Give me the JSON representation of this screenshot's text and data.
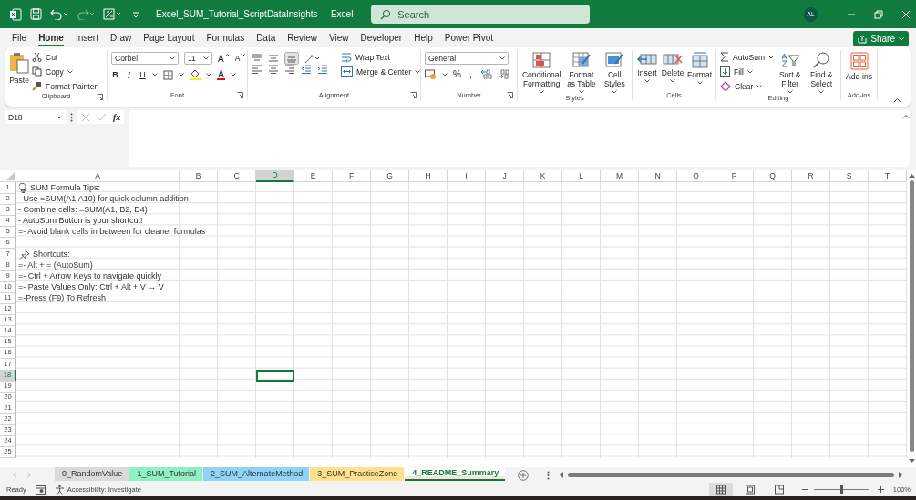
{
  "title_bar": {
    "title": "Excel_SUM_Tutorial_ScriptDataInsights  -  Excel",
    "search": {
      "placeholder": "Search"
    },
    "avatar": "AL"
  },
  "menu_tabs": [
    {
      "label": "File",
      "selected": false
    },
    {
      "label": "Home",
      "selected": true
    },
    {
      "label": "Insert",
      "selected": false
    },
    {
      "label": "Draw",
      "selected": false
    },
    {
      "label": "Page Layout",
      "selected": false
    },
    {
      "label": "Formulas",
      "selected": false
    },
    {
      "label": "Data",
      "selected": false
    },
    {
      "label": "Review",
      "selected": false
    },
    {
      "label": "View",
      "selected": false
    },
    {
      "label": "Developer",
      "selected": false
    },
    {
      "label": "Help",
      "selected": false
    },
    {
      "label": "Power Pivot",
      "selected": false
    }
  ],
  "share_button": "Share",
  "ribbon": {
    "clipboard": {
      "paste": "Paste",
      "cut": "Cut",
      "copy": "Copy",
      "format_painter": "Format Painter",
      "label": "Clipboard"
    },
    "font": {
      "font_name": "Corbel",
      "font_size": "11",
      "grow": "A",
      "shrink": "A",
      "bold": "B",
      "italic": "I",
      "underline": "U",
      "font_color": "A",
      "label": "Font"
    },
    "alignment": {
      "wrap_text": "Wrap Text",
      "merge_center": "Merge & Center",
      "label": "Alignment"
    },
    "number": {
      "format": "General",
      "percent": "%",
      "comma": ",",
      "label": "Number"
    },
    "styles": {
      "conditional_formatting": "Conditional Formatting",
      "format_as_table": "Format as Table",
      "cell_styles": "Cell Styles",
      "label": "Styles"
    },
    "cells": {
      "insert": "Insert",
      "delete": "Delete",
      "format": "Format",
      "label": "Cells"
    },
    "editing": {
      "autosum": "AutoSum",
      "fill": "Fill",
      "clear": "Clear",
      "sort_filter": "Sort & Filter",
      "find_select": "Find & Select",
      "label": "Editing"
    },
    "add_ins": {
      "button": "Add-ins",
      "label": "Add-ins"
    }
  },
  "formula_bar": {
    "name_box": "D18",
    "fx": "fx"
  },
  "sheet": {
    "columns": [
      {
        "label": "A",
        "selected": false
      },
      {
        "label": "B",
        "selected": false
      },
      {
        "label": "C",
        "selected": false
      },
      {
        "label": "D",
        "selected": true
      },
      {
        "label": "E",
        "selected": false
      },
      {
        "label": "F",
        "selected": false
      },
      {
        "label": "G",
        "selected": false
      },
      {
        "label": "H",
        "selected": false
      },
      {
        "label": "I",
        "selected": false
      },
      {
        "label": "J",
        "selected": false
      },
      {
        "label": "K",
        "selected": false
      },
      {
        "label": "L",
        "selected": false
      },
      {
        "label": "M",
        "selected": false
      },
      {
        "label": "N",
        "selected": false
      },
      {
        "label": "O",
        "selected": false
      },
      {
        "label": "P",
        "selected": false
      },
      {
        "label": "Q",
        "selected": false
      },
      {
        "label": "R",
        "selected": false
      },
      {
        "label": "S",
        "selected": false
      },
      {
        "label": "T",
        "selected": false
      }
    ],
    "rows": [
      {
        "number": "1",
        "selected": false,
        "kind": "tips-title",
        "text": "SUM Formula Tips:"
      },
      {
        "number": "2",
        "selected": false,
        "kind": "text",
        "text": "- Use =SUM(A1:A10) for quick column addition"
      },
      {
        "number": "3",
        "selected": false,
        "kind": "text",
        "text": "- Combine cells: =SUM(A1, B2, D4)"
      },
      {
        "number": "4",
        "selected": false,
        "kind": "text",
        "text": "- AutoSum Button is your shortcut!"
      },
      {
        "number": "5",
        "selected": false,
        "kind": "text",
        "text": "=- Avoid blank cells in between for cleaner formulas"
      },
      {
        "number": "6",
        "selected": false,
        "kind": "empty"
      },
      {
        "number": "7",
        "selected": false,
        "kind": "shortcuts-title",
        "text": "Shortcuts:"
      },
      {
        "number": "8",
        "selected": false,
        "kind": "text",
        "text": "=- Alt + = (AutoSum)"
      },
      {
        "number": "9",
        "selected": false,
        "kind": "text",
        "text": "=- Ctrl + Arrow Keys to navigate quickly"
      },
      {
        "number": "10",
        "selected": false,
        "kind": "text",
        "text": "=- Paste Values Only: Ctrl + Alt + V → V"
      },
      {
        "number": "11",
        "selected": false,
        "kind": "text",
        "text": "=-Press (F9) To Refresh"
      },
      {
        "number": "12",
        "selected": false,
        "kind": "empty"
      },
      {
        "number": "13",
        "selected": false,
        "kind": "empty"
      },
      {
        "number": "14",
        "selected": false,
        "kind": "empty"
      },
      {
        "number": "15",
        "selected": false,
        "kind": "empty"
      },
      {
        "number": "16",
        "selected": false,
        "kind": "empty"
      },
      {
        "number": "17",
        "selected": false,
        "kind": "empty"
      },
      {
        "number": "18",
        "selected": true,
        "kind": "empty"
      },
      {
        "number": "19",
        "selected": false,
        "kind": "empty"
      },
      {
        "number": "20",
        "selected": false,
        "kind": "empty"
      },
      {
        "number": "21",
        "selected": false,
        "kind": "empty"
      },
      {
        "number": "22",
        "selected": false,
        "kind": "empty"
      },
      {
        "number": "23",
        "selected": false,
        "kind": "empty"
      },
      {
        "number": "24",
        "selected": false,
        "kind": "empty"
      },
      {
        "number": "25",
        "selected": false,
        "kind": "empty"
      }
    ]
  },
  "sheet_tabs": [
    {
      "label": "0_RandomValue",
      "selected": false
    },
    {
      "label": "1_SUM_Tutorial",
      "selected": false,
      "color": "#8ff0c4"
    },
    {
      "label": "2_SUM_AlternateMethod",
      "selected": false,
      "color": "#8fd3f7"
    },
    {
      "label": "3_SUM_PracticeZone",
      "selected": false,
      "color": "#ffe08c"
    },
    {
      "label": "4_README_Summary",
      "selected": true
    }
  ],
  "status_bar": {
    "status": "Ready",
    "accessibility": "Accessibility: Investigate",
    "zoom": {
      "level": 0.5,
      "reading": "100%"
    }
  }
}
